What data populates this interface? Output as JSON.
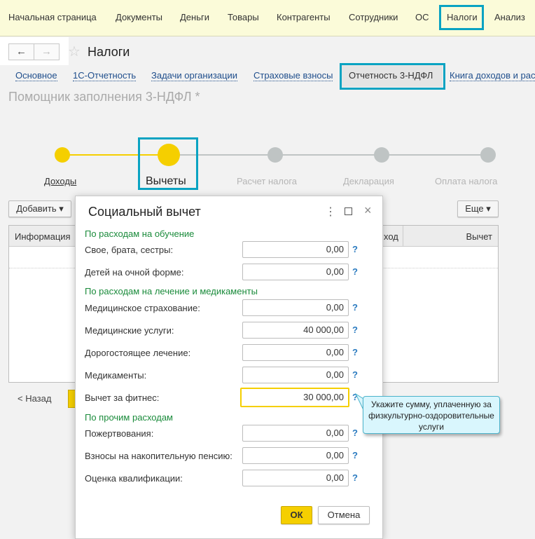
{
  "topmenu": [
    "Начальная страница",
    "Документы",
    "Деньги",
    "Товары",
    "Контрагенты",
    "Сотрудники",
    "ОС",
    "Налоги",
    "Анализ"
  ],
  "page_title": "Налоги",
  "tabs": [
    "Основное",
    "1С-Отчетность",
    "Задачи организации",
    "Страховые взносы",
    "Отчетность 3-НДФЛ",
    "Книга доходов и рас"
  ],
  "form_title": "Помощник заполнения 3-НДФЛ *",
  "steps": [
    {
      "label": "Доходы",
      "state": "done"
    },
    {
      "label": "Вычеты",
      "state": "current"
    },
    {
      "label": "Расчет налога",
      "state": "pending"
    },
    {
      "label": "Декларация",
      "state": "pending"
    },
    {
      "label": "Оплата налога",
      "state": "pending"
    }
  ],
  "toolbar": {
    "add": "Добавить",
    "more": "Еще"
  },
  "table": {
    "columns": [
      "Информация",
      "ход",
      "Вычет"
    ]
  },
  "back": "< Назад",
  "dialog": {
    "title": "Социальный вычет",
    "sections": [
      {
        "title": "По расходам на обучение",
        "fields": [
          {
            "label": "Свое, брата, сестры:",
            "value": "0,00"
          },
          {
            "label": "Детей на очной форме:",
            "value": "0,00"
          }
        ]
      },
      {
        "title": "По расходам на лечение и медикаменты",
        "fields": [
          {
            "label": "Медицинское страхование:",
            "value": "0,00"
          },
          {
            "label": "Медицинские услуги:",
            "value": "40 000,00"
          },
          {
            "label": "Дорогостоящее лечение:",
            "value": "0,00"
          },
          {
            "label": "Медикаменты:",
            "value": "0,00"
          },
          {
            "label": "Вычет за фитнес:",
            "value": "30 000,00"
          }
        ]
      },
      {
        "title": "По прочим расходам",
        "fields": [
          {
            "label": "Пожертвования:",
            "value": "0,00"
          },
          {
            "label": "Взносы на накопительную пенсию:",
            "value": "0,00"
          },
          {
            "label": "Оценка квалификации:",
            "value": "0,00"
          }
        ]
      }
    ],
    "help": "?",
    "ok": "ОК",
    "cancel": "Отмена"
  },
  "tooltip": "Укажите сумму, уплаченную за физкультурно-оздоровительные услуги",
  "colors": {
    "accent": "#f5cf00",
    "highlight": "#0aa3c2",
    "section": "#1a8b3b",
    "tooltip_bg": "#d9f6fd"
  }
}
